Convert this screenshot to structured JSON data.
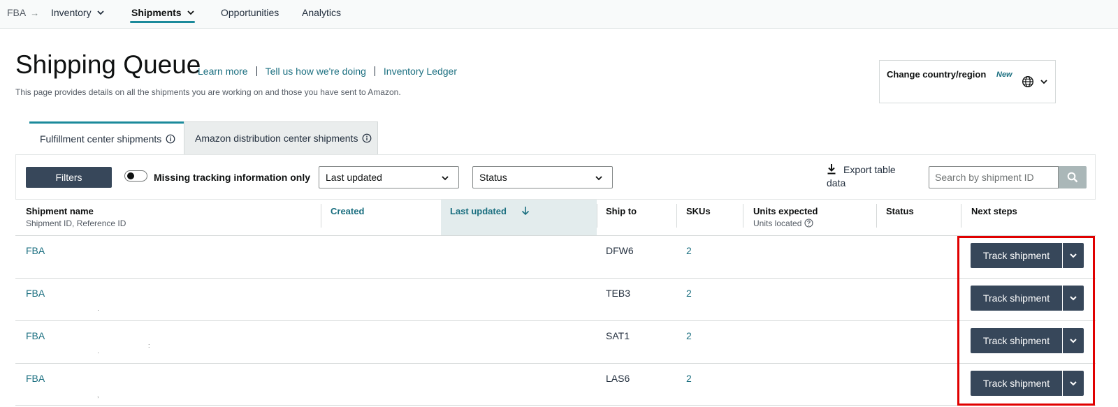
{
  "nav": {
    "breadcrumb": "FBA",
    "items": [
      {
        "label": "Inventory"
      },
      {
        "label": "Shipments"
      },
      {
        "label": "Opportunities"
      },
      {
        "label": "Analytics"
      }
    ]
  },
  "header": {
    "title": "Shipping Queue",
    "links": [
      "Learn more",
      "Tell us how we're doing",
      "Inventory Ledger"
    ],
    "subtitle": "This page provides details on all the shipments you are working on and those you have sent to Amazon."
  },
  "country": {
    "label": "Change country/region",
    "badge": "New",
    "icon": "globe-icon"
  },
  "tabs": [
    {
      "label": "Fulfillment center shipments",
      "active": true
    },
    {
      "label": "Amazon distribution center shipments",
      "active": false
    }
  ],
  "filters": {
    "button_label": "Filters",
    "toggle_label": "Missing tracking information only",
    "select_sort": "Last updated",
    "select_status": "Status",
    "export_label_1": "Export table",
    "export_label_2": "data",
    "search_placeholder": "Search by shipment ID"
  },
  "table": {
    "columns": {
      "name": "Shipment name",
      "name_sub": "Shipment ID, Reference ID",
      "created": "Created",
      "last_updated": "Last updated",
      "ship_to": "Ship to",
      "skus": "SKUs",
      "units": "Units expected",
      "units_sub": "Units located",
      "status": "Status",
      "next": "Next steps"
    },
    "rows": [
      {
        "name": "FBA",
        "ship_to": "DFW6",
        "skus": "2",
        "action": "Track shipment"
      },
      {
        "name": "FBA",
        "ship_to": "TEB3",
        "skus": "2",
        "action": "Track shipment"
      },
      {
        "name": "FBA",
        "ship_to": "SAT1",
        "skus": "2",
        "action": "Track shipment"
      },
      {
        "name": "FBA",
        "ship_to": "LAS6",
        "skus": "2",
        "action": "Track shipment"
      }
    ]
  },
  "colors": {
    "accent": "#1b8a9b",
    "link": "#1b6f80",
    "button_dark": "#37475a",
    "highlight": "#e00000"
  }
}
